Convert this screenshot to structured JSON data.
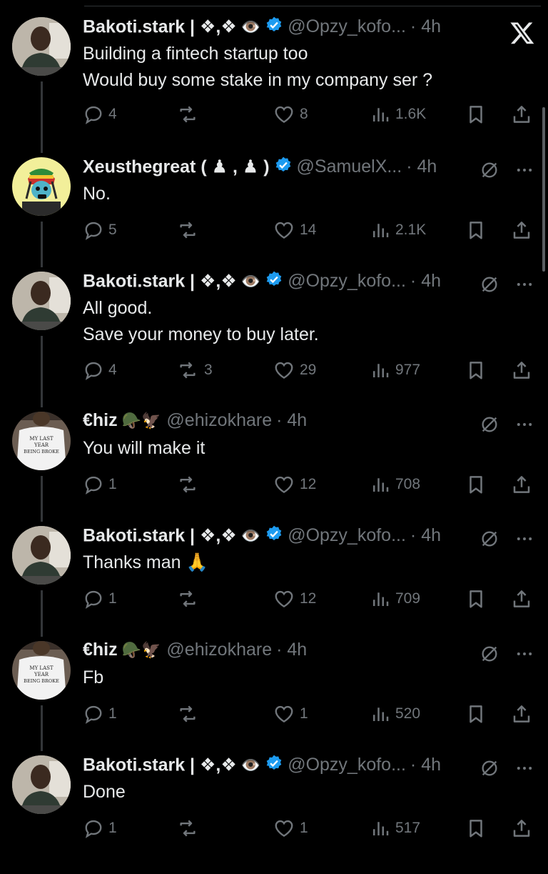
{
  "tweets": [
    {
      "name": "Bakoti.stark | ❖,❖",
      "emoji": "👁️",
      "verified": true,
      "handle": "@Opzy_kofo...",
      "time": "· 4h",
      "text": "Building a fintech startup too\nWould buy some stake in my company ser ?",
      "replies": "4",
      "reposts": "",
      "likes": "8",
      "views": "1.6K",
      "avatar": "bakoti"
    },
    {
      "name": "Xeusthegreat ( ♟ , ♟ )",
      "emoji": "",
      "verified": true,
      "handle": "@SamuelX...",
      "time": "· 4h",
      "text": "No.",
      "replies": "5",
      "reposts": "",
      "likes": "14",
      "views": "2.1K",
      "avatar": "xeus"
    },
    {
      "name": "Bakoti.stark | ❖,❖",
      "emoji": "👁️",
      "verified": true,
      "handle": "@Opzy_kofo...",
      "time": "· 4h",
      "text": "All good.\nSave your money to buy later.",
      "replies": "4",
      "reposts": "3",
      "likes": "29",
      "views": "977",
      "avatar": "bakoti"
    },
    {
      "name": "€hiz",
      "emoji": "🪖🦅",
      "verified": false,
      "handle": "@ehizokhare",
      "time": "· 4h",
      "text": "You will make it",
      "replies": "1",
      "reposts": "",
      "likes": "12",
      "views": "708",
      "avatar": "chiz"
    },
    {
      "name": "Bakoti.stark | ❖,❖",
      "emoji": "👁️",
      "verified": true,
      "handle": "@Opzy_kofo...",
      "time": "· 4h",
      "text": "Thanks man 🙏",
      "replies": "1",
      "reposts": "",
      "likes": "12",
      "views": "709",
      "avatar": "bakoti"
    },
    {
      "name": "€hiz",
      "emoji": "🪖🦅",
      "verified": false,
      "handle": "@ehizokhare",
      "time": "· 4h",
      "text": "Fb",
      "replies": "1",
      "reposts": "",
      "likes": "1",
      "views": "520",
      "avatar": "chiz"
    },
    {
      "name": "Bakoti.stark | ❖,❖",
      "emoji": "👁️",
      "verified": true,
      "handle": "@Opzy_kofo...",
      "time": "· 4h",
      "text": "Done",
      "replies": "1",
      "reposts": "",
      "likes": "1",
      "views": "517",
      "avatar": "bakoti"
    }
  ],
  "avatar_texts": {
    "chiz_shirt": [
      "MY LAST",
      "YEAR",
      "BEING BROKE"
    ]
  },
  "colors": {
    "background": "#000000",
    "text": "#e7e9ea",
    "muted": "#71767b",
    "verified": "#1d9bf0"
  },
  "icons": {
    "logo": "x-logo-icon",
    "mute": "muted-conversation-icon",
    "more": "more-icon"
  }
}
